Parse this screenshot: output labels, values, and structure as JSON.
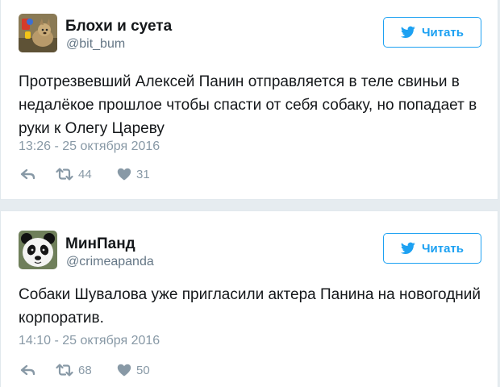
{
  "colors": {
    "accent": "#1da1f2",
    "text": "#14171a",
    "muted": "#8899a6",
    "background": "#e6ecf0"
  },
  "tweets": [
    {
      "user_name": "Блохи и суета",
      "user_handle": "@bit_bum",
      "follow_label": "Читать",
      "text": "Протрезвевший Алексей Панин отправляется в теле свиньи в недалёкое прошлое чтобы спасти от себя собаку, но попадает в руки к Олегу Цареву",
      "timestamp": "13:26 - 25 октября 2016",
      "retweets": "44",
      "likes": "31",
      "avatar_icon": "dog-avatar-icon"
    },
    {
      "user_name": "МинПанд",
      "user_handle": "@crimeapanda",
      "follow_label": "Читать",
      "text": "Собаки Шувалова уже пригласили актера Панина на новогодний корпоратив.",
      "timestamp": "14:10 - 25 октября 2016",
      "retweets": "68",
      "likes": "50",
      "avatar_icon": "panda-avatar-icon"
    }
  ]
}
